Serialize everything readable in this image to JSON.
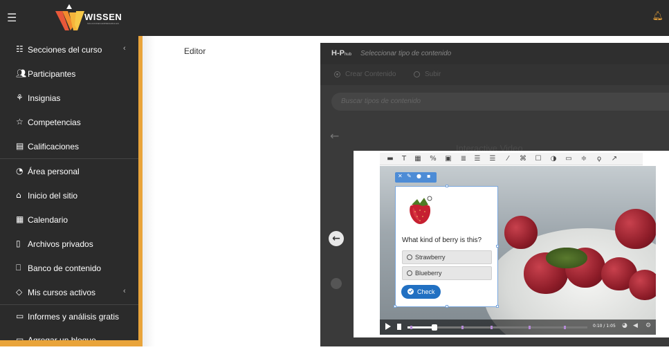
{
  "header": {
    "brand": "WISSEN",
    "brand_sub": "SOLUCIONES EMPRESARIALES"
  },
  "sidebar": {
    "items": [
      {
        "label": "Secciones del curso",
        "icon": "list-icon",
        "chevron": "‹"
      },
      {
        "label": "Participantes",
        "icon": "users-icon"
      },
      {
        "label": "Insignias",
        "icon": "badge-icon"
      },
      {
        "label": "Competencias",
        "icon": "star-icon"
      },
      {
        "label": "Calificaciones",
        "icon": "book-icon"
      },
      {
        "label": "Área personal",
        "icon": "dashboard-icon"
      },
      {
        "label": "Inicio del sitio",
        "icon": "home-icon"
      },
      {
        "label": "Calendario",
        "icon": "calendar-icon"
      },
      {
        "label": "Archivos privados",
        "icon": "files-icon"
      },
      {
        "label": "Banco de contenido",
        "icon": "box-icon"
      },
      {
        "label": "Mis cursos activos",
        "icon": "graduation-cap-icon",
        "chevron": "‹"
      },
      {
        "label": "Informes y análisis gratis",
        "icon": "folder-icon"
      },
      {
        "label": "Agregar un bloque",
        "icon": "folder-icon"
      }
    ]
  },
  "main": {
    "editor_label": "Editor"
  },
  "h5p": {
    "logo": "H-P",
    "logo_suffix": "hub",
    "header_title": "Seleccionar tipo de contenido",
    "tab_create": "Crear Contenido",
    "tab_upload": "Subir",
    "search_placeholder": "Buscar tipos de contenido",
    "content_title": "Interactive Video"
  },
  "video": {
    "time": "0:10 / 1:05",
    "question": "What kind of berry is this?",
    "options": [
      "Strawberry",
      "Blueberry"
    ],
    "check_label": "Check"
  },
  "colors": {
    "sidebar_bg": "#2b2b2b",
    "accent": "#e9a43a",
    "check_button": "#2170c2"
  }
}
